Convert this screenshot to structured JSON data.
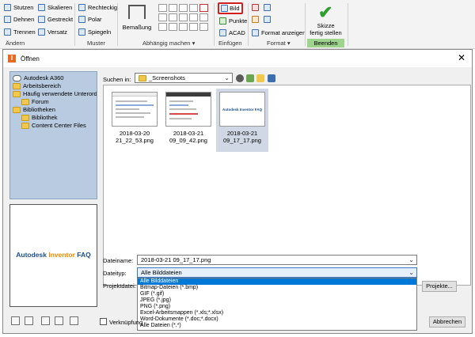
{
  "ribbon": {
    "aendern": {
      "group": "Ändern",
      "items": [
        "Stutzen",
        "Dehnen",
        "Trennen"
      ],
      "items2": [
        "Skalieren",
        "Gestreckt",
        "Versatz"
      ]
    },
    "muster": {
      "group": "Muster",
      "items": [
        "Rechteckig",
        "Polar",
        "Spiegeln"
      ]
    },
    "abhaengig": {
      "group": "Abhängig machen",
      "bemassung": "Bemaßung"
    },
    "einfuegen": {
      "group": "Einfügen",
      "items": [
        "Bild",
        "Punkte",
        "ACAD"
      ]
    },
    "format": {
      "group": "Format",
      "format_anzeigen": "Format anzeigen"
    },
    "beenden": {
      "group": "Beenden",
      "skizze": "Skizze",
      "fertig_stellen": "fertig stellen"
    }
  },
  "dialog": {
    "title": "Öffnen",
    "places": [
      {
        "label": "Autodesk A360",
        "icon": "cloud-icon"
      },
      {
        "label": "Arbeitsbereich",
        "icon": "folder-icon"
      },
      {
        "label": "Häufig verwendete Unterordner",
        "icon": "folder-icon"
      },
      {
        "label": "Forum",
        "icon": "folder-icon"
      },
      {
        "label": "Bibliotheken",
        "icon": "folder-icon"
      },
      {
        "label": "Bibliothek",
        "icon": "folder-icon"
      },
      {
        "label": "Content Center Files",
        "icon": "folder-icon"
      }
    ],
    "preview_logo": {
      "part1": "Autodesk ",
      "part2": "Inventor",
      "part3": " FAQ"
    },
    "suchen_in_label": "Suchen in:",
    "suchen_in_value": "_Screenshots",
    "files": [
      {
        "line1": "2018-03-20",
        "line2": "21_22_53.png",
        "selected": false
      },
      {
        "line1": "2018-03-21",
        "line2": "09_09_42.png",
        "selected": false
      },
      {
        "line1": "2018-03-21",
        "line2": "09_17_17.png",
        "selected": true
      }
    ],
    "thumb_logo": "Autodesk Inventor FAQ",
    "dateiname_label": "Dateiname:",
    "dateiname_value": "2018-03-21 09_17_17.png",
    "dateityp_label": "Dateityp:",
    "dateityp_value": "Alle Bilddateien",
    "projektdatei_label": "Projektdatei:",
    "projekte_button": "Projekte...",
    "dateityp_options": [
      "Alle Bilddateien",
      "Bitmap-Dateien (*.bmp)",
      "GIF (*.gif)",
      "JPEG (*.jpg)",
      "PNG (*.png)",
      "Excel-Arbeitsmappen (*.xls;*.xlsx)",
      "Word-Dokumente (*.doc;*.docx)",
      "Alle Dateien (*.*)"
    ],
    "verknuepfung_label": "Verknüpfung",
    "abbrechen_button": "Abbrechen"
  }
}
